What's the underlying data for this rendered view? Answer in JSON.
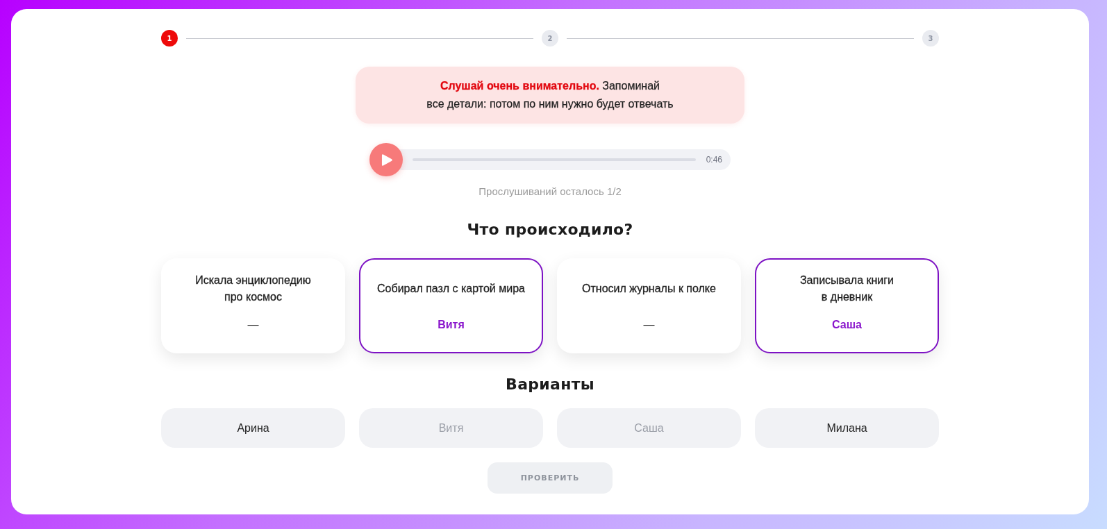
{
  "stepper": {
    "steps": [
      {
        "label": "1",
        "selected": true
      },
      {
        "label": "2",
        "selected": false
      },
      {
        "label": "3",
        "selected": false
      }
    ]
  },
  "notice": {
    "text": "**Слушай очень внимательно.** Запоминай\nвсе детали: потом по ним нужно будет отвечать"
  },
  "player": {
    "time": "0:46",
    "listens_left": "Прослушиваний осталось 1/2"
  },
  "question": {
    "title": "Что происходило?",
    "cards": [
      {
        "text": "Искала энциклопедию\nпро космос",
        "answer": "—",
        "filled": false
      },
      {
        "text": "Собирал пазл с картой мира",
        "answer": "Витя",
        "filled": true
      },
      {
        "text": "Относил журналы к полке",
        "answer": "—",
        "filled": false
      },
      {
        "text": "Записывала книги\nв дневник",
        "answer": "Саша",
        "filled": true
      }
    ]
  },
  "options": {
    "title": "Варианты",
    "items": [
      {
        "label": "Арина",
        "disabled": false
      },
      {
        "label": "Витя",
        "disabled": true
      },
      {
        "label": "Саша",
        "disabled": true
      },
      {
        "label": "Милана",
        "disabled": false
      }
    ]
  },
  "check_button": {
    "label": "ПРОВЕРИТЬ",
    "disabled": true
  }
}
